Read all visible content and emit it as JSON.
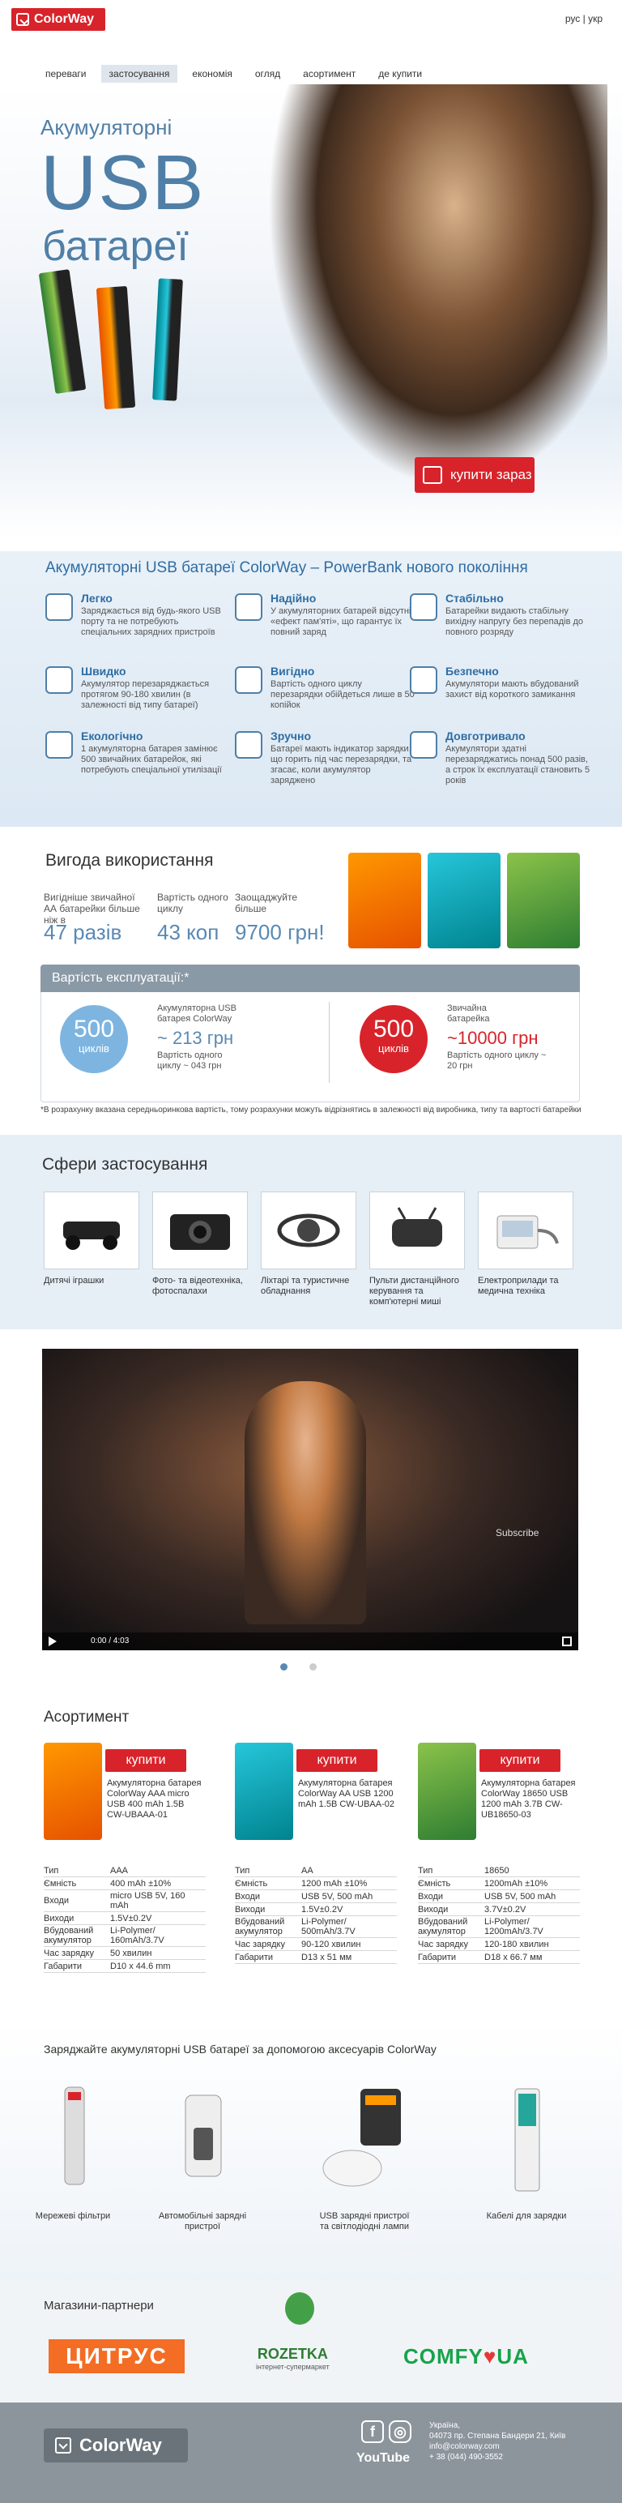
{
  "header": {
    "logo": "ColorWay",
    "lang": [
      "рус",
      "|",
      "укр"
    ],
    "nav": [
      "переваги",
      "застосування",
      "економія",
      "огляд",
      "асортимент",
      "де купити"
    ]
  },
  "hero": {
    "line1": "Акумуляторні",
    "line2": "USB",
    "line3": "батареї",
    "buy": "купити зараз"
  },
  "features": {
    "title": "Акумуляторні USB батареї ColorWay – PowerBank нового покоління",
    "items": [
      {
        "title": "Легко",
        "desc": "Заряджається від будь-якого USB порту та не потребують спеціальних зарядних пристроїв"
      },
      {
        "title": "Надійно",
        "desc": "У акумуляторних батарей відсутній «ефект пам'яті», що гарантує їх повний заряд"
      },
      {
        "title": "Стабільно",
        "desc": "Батарейки видають стабільну вихідну напругу без перепадів до повного розряду"
      },
      {
        "title": "Швидко",
        "desc": "Акумулятор перезаряджається протягом 90-180 хвилин (в залежності від типу батареї)"
      },
      {
        "title": "Вигідно",
        "desc": "Вартість одного циклу перезарядки обійдеться лише в 50 копійок"
      },
      {
        "title": "Безпечно",
        "desc": "Акумулятори мають вбудований захист від короткого замикання"
      },
      {
        "title": "Екологічно",
        "desc": "1 акумуляторна батарея замінює 500 звичайних батарейок, які потребують спеціальної утилізації"
      },
      {
        "title": "Зручно",
        "desc": "Батареї мають індикатор зарядки, що горить під час перезарядки, та згасає, коли акумулятор заряджено"
      },
      {
        "title": "Довготривало",
        "desc": "Акумулятори здатні перезаряджатись понад 500 разів, а строк їх експлуатації становить 5 років"
      }
    ]
  },
  "benefit": {
    "title": "Вигода використання",
    "cols": [
      {
        "label": "Вигідніше звичайної АА батарейки більше ніж в",
        "value": "47 разів"
      },
      {
        "label": "Вартість одного циклу",
        "value": "43 коп"
      },
      {
        "label": "Заощаджуйте більше",
        "value": "9700 грн!"
      }
    ]
  },
  "cost": {
    "title": "Вартість експлуатації:*",
    "left": {
      "n": "500",
      "u": "циклів",
      "label": "Акумуляторна USB батарея ColorWay",
      "value": "~ 213 грн",
      "note": "Вартість одного циклу ~ 043 грн"
    },
    "right": {
      "n": "500",
      "u": "циклів",
      "label": "Звичайна батарейка",
      "value": "~10000 грн",
      "note": "Вартість одного циклу ~ 20 грн"
    },
    "footnote": "*В розрахунку вказана середньоринкова вартість, тому розрахунки можуть відрізнятись в залежності від виробника, типу та вартості батарейки"
  },
  "spheres": {
    "title": "Сфери застосування",
    "items": [
      "Дитячі іграшки",
      "Фото- та відеотехніка, фотоспалахи",
      "Ліхтарі та туристичне обладнання",
      "Пульти дистанційного керування та комп'ютерні миші",
      "Електроприлади та медична техніка"
    ]
  },
  "video": {
    "time": "0:00 / 4:03",
    "subscribe": "Subscribe"
  },
  "assortment": {
    "title": "Асортимент",
    "buy": "купити",
    "products": [
      {
        "name": "Акумуляторна батарея ColorWay AAA micro USB 400 mAh 1.5B CW-UBAAA-01",
        "specs": [
          [
            "Тип",
            "AAA"
          ],
          [
            "Ємність",
            "400 mAh ±10%"
          ],
          [
            "Входи",
            "micro USB 5V, 160 mAh"
          ],
          [
            "Виходи",
            "1.5V±0.2V"
          ],
          [
            "Вбудований акумулятор",
            "Li-Polymer/ 160mAh/3.7V"
          ],
          [
            "Час зарядку",
            "50 хвилин"
          ],
          [
            "Габарити",
            "D10 x 44.6 mm"
          ]
        ]
      },
      {
        "name": "Акумуляторна батарея ColorWay AA USB 1200 mAh 1.5B CW-UBAA-02",
        "specs": [
          [
            "Тип",
            "AA"
          ],
          [
            "Ємність",
            "1200 mAh ±10%"
          ],
          [
            "Входи",
            "USB 5V, 500 mAh"
          ],
          [
            "Виходи",
            "1.5V±0.2V"
          ],
          [
            "Вбудований акумулятор",
            "Li-Polymer/ 500mAh/3.7V"
          ],
          [
            "Час зарядку",
            "90-120 хвилин"
          ],
          [
            "Габарити",
            "D13 x 51 мм"
          ]
        ]
      },
      {
        "name": "Акумуляторна батарея ColorWay 18650 USB 1200 mAh 3.7B CW-UB18650-03",
        "specs": [
          [
            "Тип",
            "18650"
          ],
          [
            "Ємність",
            "1200mAh ±10%"
          ],
          [
            "Входи",
            "USB 5V, 500 mAh"
          ],
          [
            "Виходи",
            "3.7V±0.2V"
          ],
          [
            "Вбудований акумулятор",
            "Li-Polymer/ 1200mAh/3.7V"
          ],
          [
            "Час зарядку",
            "120-180 хвилин"
          ],
          [
            "Габарити",
            "D18 x 66.7 мм"
          ]
        ]
      }
    ]
  },
  "accessories": {
    "title": "Заряджайте акумуляторні USB батареї за допомогою аксесуарів ColorWay",
    "items": [
      "Мережеві фільтри",
      "Автомобільні зарядні пристрої",
      "USB зарядні пристрої та світлодіодні лампи",
      "Кабелі для зарядки"
    ]
  },
  "partners": {
    "title": "Магазини-партнери",
    "citrus": "ЦИТРУС",
    "rozetka": "ROZETKA",
    "rozetka_sub": "інтернет-супермаркет",
    "comfy": "COMFY",
    "comfy_ua": "UA"
  },
  "footer": {
    "logo": "ColorWay",
    "youtube": "YouTube",
    "address": [
      "Україна,",
      "04073 пр. Степана Бандери 21, Київ",
      "info@colorway.com",
      "+ 38 (044) 490-3552"
    ]
  },
  "colors": {
    "brand_red": "#d8232a",
    "accent_blue": "#4f7fa7"
  }
}
